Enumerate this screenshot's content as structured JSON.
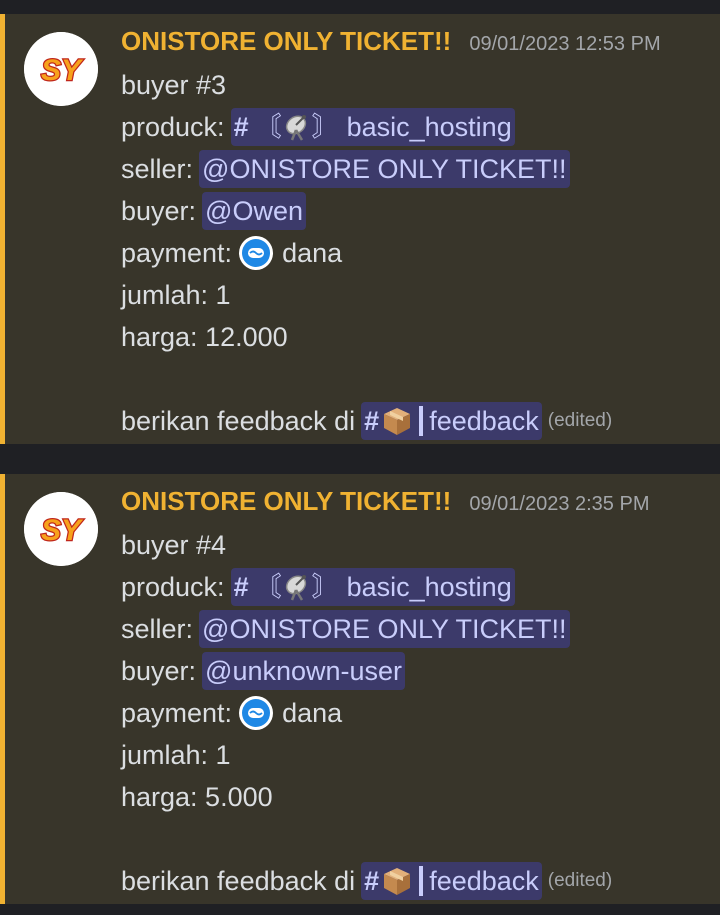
{
  "messages": [
    {
      "author": "ONISTORE ONLY TICKET!!",
      "timestamp": "09/01/2023 12:53 PM",
      "avatar_text": "SY",
      "title": "buyer #3",
      "product_label": "produck:",
      "product_channel": "basic_hosting",
      "seller_label": "seller:",
      "seller_mention": "@ONISTORE ONLY TICKET!!",
      "buyer_label": "buyer:",
      "buyer_mention": "@Owen",
      "payment_label": "payment:",
      "payment_method": "dana",
      "qty_line": "jumlah: 1",
      "price_line": "harga: 12.000",
      "feedback_text": "berikan feedback di",
      "feedback_channel": "feedback",
      "edited": "(edited)"
    },
    {
      "author": "ONISTORE ONLY TICKET!!",
      "timestamp": "09/01/2023 2:35 PM",
      "avatar_text": "SY",
      "title": "buyer #4",
      "product_label": "produck:",
      "product_channel": "basic_hosting",
      "seller_label": "seller:",
      "seller_mention": "@ONISTORE ONLY TICKET!!",
      "buyer_label": "buyer:",
      "buyer_mention": "@unknown-user",
      "payment_label": "payment:",
      "payment_method": "dana",
      "qty_line": "jumlah: 1",
      "price_line": "harga: 5.000",
      "feedback_text": "berikan feedback di",
      "feedback_channel": "feedback",
      "edited": "(edited)"
    }
  ],
  "icons": {
    "avatar": "sy-logo-icon",
    "product": "satellite-dish-icon",
    "payment": "dana-wallet-icon",
    "feedback": "package-box-icon"
  },
  "colors": {
    "accent": "#f0b232",
    "mention_bg": "#3c3a6a",
    "mention_text": "#c9cdfb",
    "message_bg": "#38352a"
  }
}
